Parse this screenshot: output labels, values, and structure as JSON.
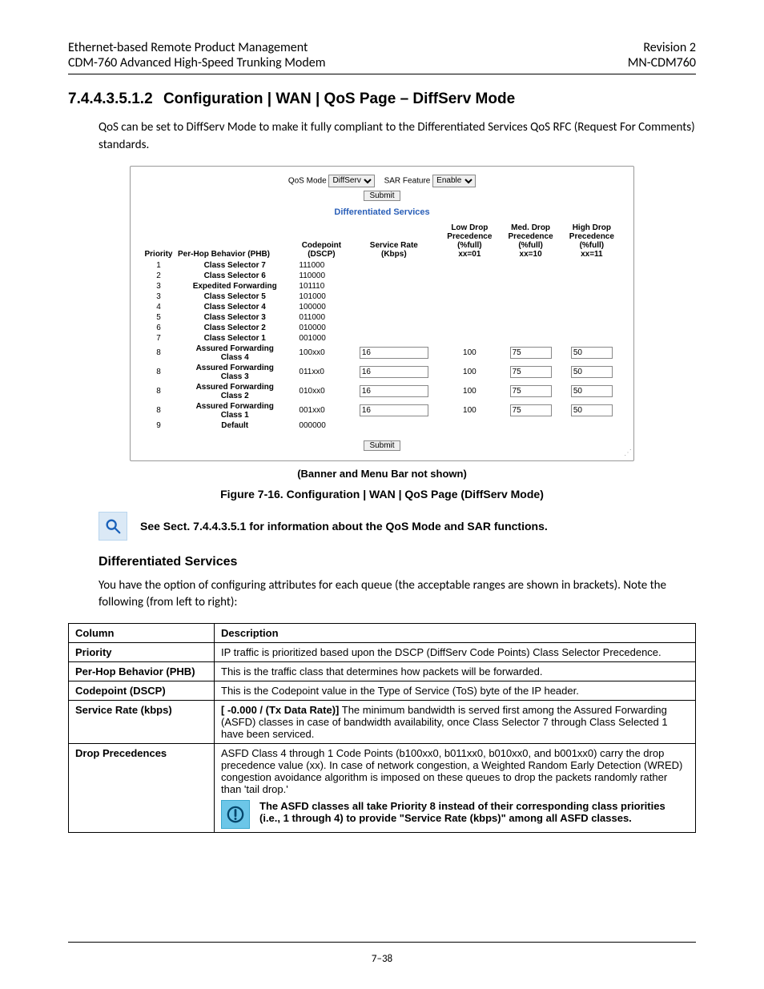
{
  "header": {
    "left1": "Ethernet-based Remote Product Management",
    "right1": "Revision 2",
    "left2": "CDM-760 Advanced High-Speed Trunking Modem",
    "right2": "MN-CDM760"
  },
  "section": {
    "number": "7.4.4.3.5.1.2",
    "title": "Configuration | WAN | QoS Page – DiffServ Mode"
  },
  "intro": "QoS can be set to DiffServ Mode to make it fully compliant to the Differentiated Services QoS RFC (Request For Comments) standards.",
  "shot": {
    "qos_mode_label": "QoS Mode",
    "qos_mode_value": "DiffServ",
    "sar_label": "SAR Feature",
    "sar_value": "Enable",
    "submit": "Submit",
    "ds_title": "Differentiated Services",
    "headers": {
      "priority": "Priority",
      "phb": "Per-Hop Behavior (PHB)",
      "dscp": "Codepoint (DSCP)",
      "rate": "Service Rate (Kbps)",
      "low": "Low Drop Precedence (%full) xx=01",
      "med": "Med. Drop Precedence (%full) xx=10",
      "high": "High Drop Precedence (%full) xx=11"
    },
    "rows": [
      {
        "p": "1",
        "phb": "Class Selector 7",
        "cp": "111000"
      },
      {
        "p": "2",
        "phb": "Class Selector 6",
        "cp": "110000"
      },
      {
        "p": "3",
        "phb": "Expedited Forwarding",
        "cp": "101110"
      },
      {
        "p": "3",
        "phb": "Class Selector 5",
        "cp": "101000"
      },
      {
        "p": "4",
        "phb": "Class Selector 4",
        "cp": "100000"
      },
      {
        "p": "5",
        "phb": "Class Selector 3",
        "cp": "011000"
      },
      {
        "p": "6",
        "phb": "Class Selector 2",
        "cp": "010000"
      },
      {
        "p": "7",
        "phb": "Class Selector 1",
        "cp": "001000"
      },
      {
        "p": "8",
        "phb": "Assured Forwarding Class 4",
        "cp": "100xx0",
        "rate": "16",
        "low": "100",
        "med": "75",
        "high": "50"
      },
      {
        "p": "8",
        "phb": "Assured Forwarding Class 3",
        "cp": "011xx0",
        "rate": "16",
        "low": "100",
        "med": "75",
        "high": "50"
      },
      {
        "p": "8",
        "phb": "Assured Forwarding Class 2",
        "cp": "010xx0",
        "rate": "16",
        "low": "100",
        "med": "75",
        "high": "50"
      },
      {
        "p": "8",
        "phb": "Assured Forwarding Class 1",
        "cp": "001xx0",
        "rate": "16",
        "low": "100",
        "med": "75",
        "high": "50"
      },
      {
        "p": "9",
        "phb": "Default",
        "cp": "000000"
      }
    ]
  },
  "banner_note": "(Banner and Menu Bar not shown)",
  "figure": "Figure 7-16. Configuration | WAN | QoS Page (DiffServ Mode)",
  "see_note": "See Sect. 7.4.4.3.5.1 for information about the QoS Mode and SAR functions.",
  "sub_heading": "Differentiated Services",
  "sub_body": "You have the option of configuring attributes for each queue (the acceptable ranges are shown in brackets). Note the following (from left to right):",
  "desc": {
    "h1": "Column",
    "h2": "Description",
    "rows": [
      {
        "c": "Priority",
        "d": "IP traffic is prioritized based upon the DSCP (DiffServ Code Points) Class Selector Precedence."
      },
      {
        "c": "Per-Hop Behavior (PHB)",
        "d": "This is the traffic class that determines how packets will be forwarded."
      },
      {
        "c": "Codepoint (DSCP)",
        "d": "This is the Codepoint value in the Type of Service (ToS) byte of the IP header."
      },
      {
        "c": "Service Rate (kbps)",
        "d_lead": "[ -0.000 / (Tx Data Rate)]",
        "d_rest": " The minimum bandwidth is served first among the Assured Forwarding (ASFD) classes in case of bandwidth availability, once Class Selector 7 through Class Selected 1 have been serviced."
      },
      {
        "c": "Drop Precedences",
        "d": "ASFD Class 4 through 1 Code Points (b100xx0, b011xx0, b010xx0, and b001xx0) carry the drop precedence value (xx). In case of network congestion, a Weighted Random Early Detection (WRED) congestion avoidance algorithm is imposed on these queues to drop the packets randomly rather than 'tail drop.'",
        "alert": "The ASFD classes all take Priority 8 instead of their corresponding class priorities (i.e., 1 through 4) to provide \"Service Rate (kbps)\" among all ASFD classes."
      }
    ]
  },
  "page_num": "7–38"
}
